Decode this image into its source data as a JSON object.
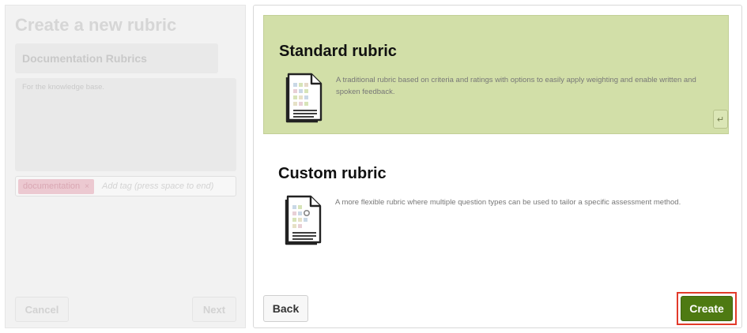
{
  "form": {
    "title": "Create a new rubric",
    "name_value": "Documentation Rubrics",
    "description_value": "For the knowledge base.",
    "tag_chip": "documentation",
    "tag_remove": "×",
    "tag_placeholder": "Add tag (press space to end)",
    "cancel_label": "Cancel",
    "next_label": "Next"
  },
  "options": {
    "standard": {
      "title": "Standard rubric",
      "description": "A traditional rubric based on criteria and ratings with options to easily apply weighting and enable written and spoken feedback.",
      "icon": "standard-rubric-icon",
      "enter_key": "↵"
    },
    "custom": {
      "title": "Custom rubric",
      "description": "A more flexible rubric where multiple question types can be used to tailor a specific assessment method.",
      "icon": "custom-rubric-icon"
    }
  },
  "actions": {
    "back_label": "Back",
    "create_label": "Create"
  },
  "colors": {
    "selected_card": "#d2dfa8",
    "create_button": "#4e7a12",
    "highlight_outline": "#e23a2a",
    "tag_chip": "#ecc9d1"
  }
}
